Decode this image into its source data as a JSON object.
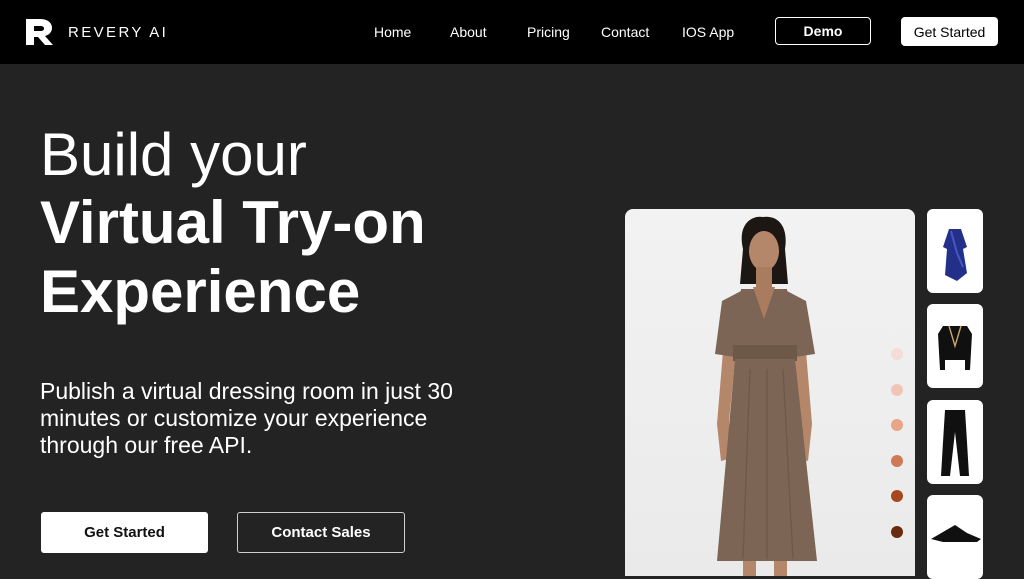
{
  "nav": {
    "brand": "REVERY AI",
    "links": [
      "Home",
      "About",
      "Pricing",
      "Contact",
      "IOS App"
    ],
    "demo_label": "Demo",
    "get_started_label": "Get Started"
  },
  "hero": {
    "line1": "Build your",
    "line2": "Virtual Try-on",
    "line3": "Experience",
    "subtitle": "Publish a virtual dressing room in just 30 minutes or customize your experience through our free API.",
    "primary_cta": "Get Started",
    "secondary_cta": "Contact Sales"
  },
  "showcase": {
    "swatches": [
      "#f6dcd9",
      "#f1c4b7",
      "#e9a588",
      "#cf7a57",
      "#a8471f",
      "#6a2a0f"
    ],
    "thumbnails": [
      "blue-satin-wrap-dress",
      "black-cropped-jacket",
      "black-flared-pants",
      "black-pointed-mule"
    ]
  },
  "colors": {
    "nav_bg": "#000000",
    "page_bg": "#232323",
    "dress": "#7c6555"
  }
}
